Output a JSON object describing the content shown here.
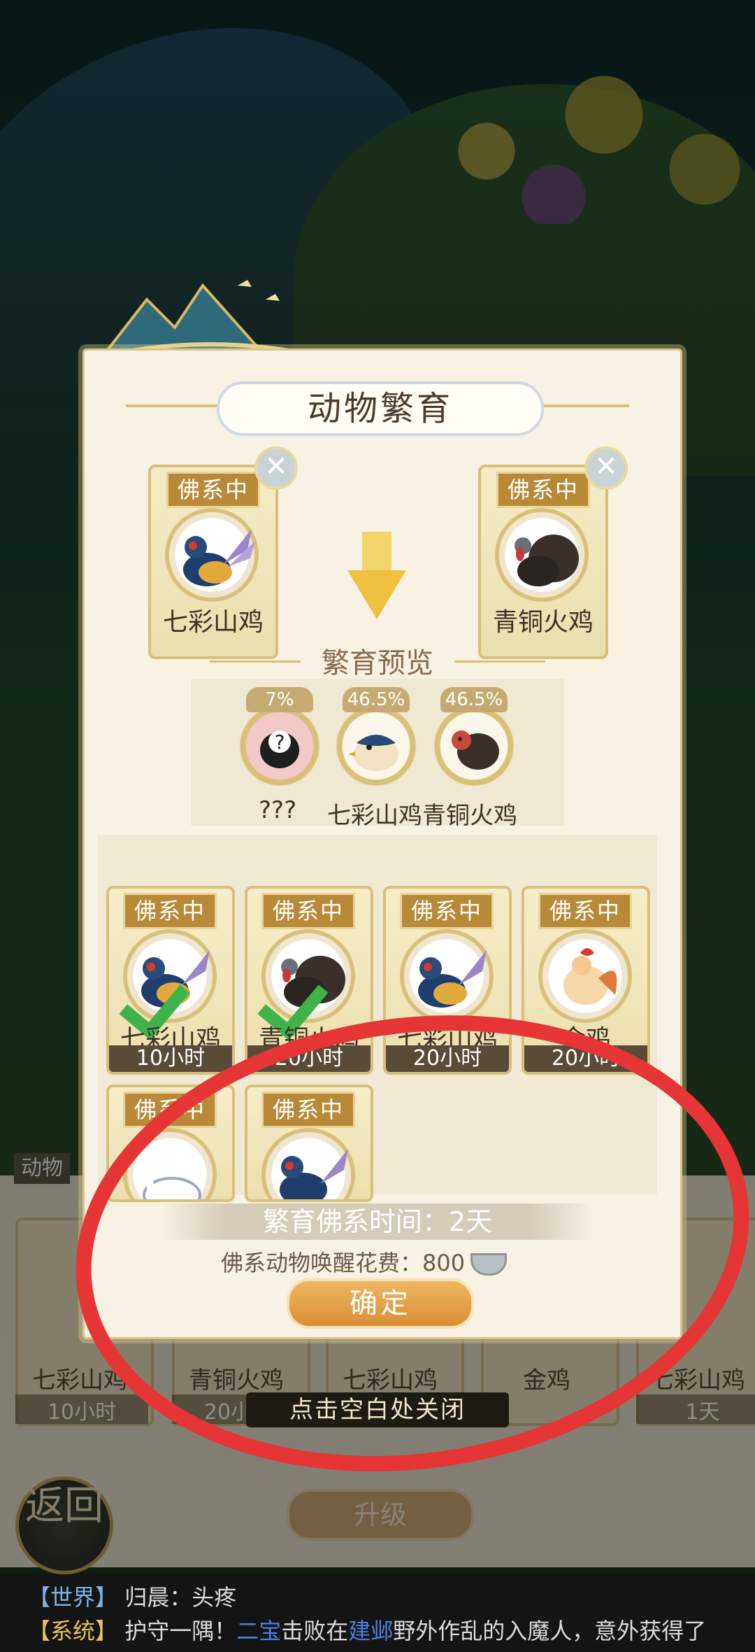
{
  "dialog": {
    "title": "动物繁育",
    "parent_left": {
      "tag": "佛系中",
      "name": "七彩山鸡"
    },
    "parent_right": {
      "tag": "佛系中",
      "name": "青铜火鸡"
    },
    "preview_title": "繁育预览",
    "preview": [
      {
        "pct": "7%",
        "name": "???"
      },
      {
        "pct": "46.5%",
        "name": "七彩山鸡"
      },
      {
        "pct": "46.5%",
        "name": "青铜火鸡"
      }
    ],
    "grid": [
      {
        "tag": "佛系中",
        "name": "七彩山鸡",
        "time": "10小时",
        "selected": true
      },
      {
        "tag": "佛系中",
        "name": "青铜火鸡",
        "time": "20小时",
        "selected": true
      },
      {
        "tag": "佛系中",
        "name": "七彩山鸡",
        "time": "20小时",
        "selected": false
      },
      {
        "tag": "佛系中",
        "name": "金鸡",
        "time": "20小时",
        "selected": false
      },
      {
        "tag": "佛系中",
        "name": "",
        "time": "",
        "selected": false
      },
      {
        "tag": "佛系中",
        "name": "",
        "time": "",
        "selected": false
      }
    ],
    "breed_time": "繁育佛系时间：2天",
    "wake_cost_label": "佛系动物唤醒花费：800",
    "confirm": "确定"
  },
  "background": {
    "side_label": "动物",
    "cards": [
      {
        "name": "七彩山鸡",
        "time": "10小时"
      },
      {
        "name": "青铜火鸡",
        "time": "20小时"
      },
      {
        "name": "七彩山鸡",
        "time": ""
      },
      {
        "name": "金鸡",
        "time": ""
      },
      {
        "name": "七彩山鸡",
        "time": "1天"
      }
    ],
    "upgrade": "升级",
    "return": "返回"
  },
  "close_hint": "点击空白处关闭",
  "chat": [
    {
      "channel": "【世界】",
      "text": "归晨：头疼"
    },
    {
      "channel": "【系统】",
      "text_pre": "护守一隅！",
      "player": "二宝",
      "text_mid": "击败在",
      "place": "建邺",
      "text_post": "野外作乱的入魔人，意外获得了"
    }
  ],
  "colors": {
    "accent_gold": "#d8c07a",
    "tag_brown": "#b88a37",
    "confirm_orange": "#e09a3f",
    "check_green": "#3fb34a",
    "annotation_red": "#e53535"
  }
}
